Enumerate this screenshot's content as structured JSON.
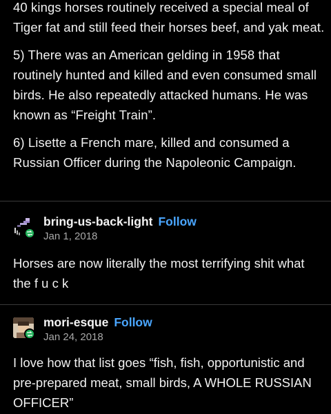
{
  "post": {
    "paragraphs": [
      "40 kings horses routinely received a special meal of Tiger fat and still feed their horses beef, and yak meat.",
      "5) There was an American gelding in 1958 that routinely hunted and killed and even consumed small birds. He also repeatedly attacked   humans. He was known as “Freight Train”.",
      "6) Lisette a French mare, killed and consumed a Russian Officer during the Napoleonic Campaign."
    ]
  },
  "reblogs": [
    {
      "username": "bring-us-back-light",
      "follow_label": "Follow",
      "date": "Jan 1, 2018",
      "text": "Horses are now literally the most terrifying shit what the f u c k",
      "avatar_icon": "pixel-art-avatar",
      "badge_icon": "reblog-icon"
    },
    {
      "username": "mori-esque",
      "follow_label": "Follow",
      "date": "Jan 24, 2018",
      "text": "I love how that list goes “fish, fish, opportunistic and pre-prepared meat, small birds, A WHOLE RUSSIAN OFFICER”",
      "avatar_icon": "photo-avatar",
      "badge_icon": "reblog-icon"
    }
  ],
  "colors": {
    "background": "#000000",
    "text": "#f1f1f1",
    "follow": "#4aa6ff",
    "date": "#a8a8a8",
    "badge": "#22b35a",
    "divider": "#3a3a3a"
  }
}
